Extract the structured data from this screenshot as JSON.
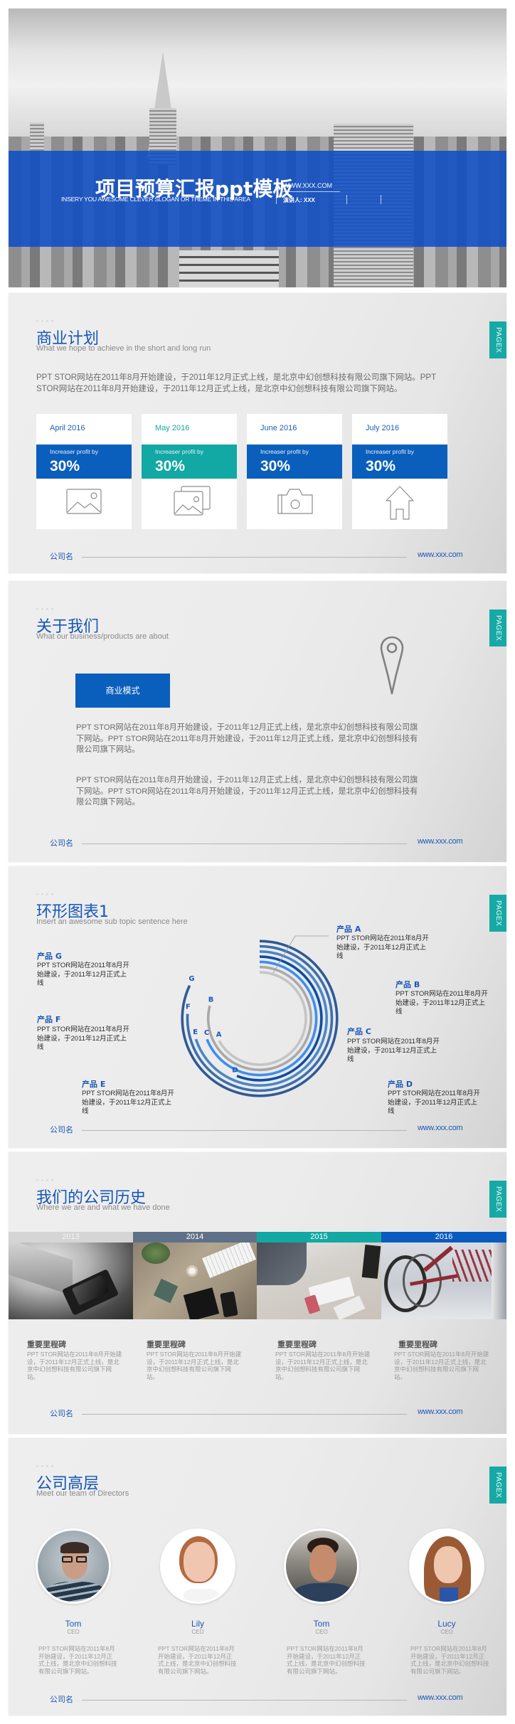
{
  "cover": {
    "title": "项目预算汇报ppt模板",
    "slogan": "INSERY YOU AWESOME CLEVER SLOGAN OR THEME IN THIS AREA",
    "website": "WWW.XXX.COM",
    "speaker": "演讲人: XXX",
    "band_color": "#104ec4"
  },
  "common": {
    "decor_dots": "• • • •",
    "page_tab": "PAGEX",
    "footer_company": "公司名",
    "footer_url": "www.xxx.com",
    "accent_blue": "#0b5fbc",
    "accent_teal": "#17a9a5"
  },
  "business_plan": {
    "title": "商业计划",
    "subtitle": "What we hope to achieve  in the short and long run",
    "body": "PPT STOR网站在2011年8月开始建设，于2011年12月正式上线，是北京中幻创想科技有限公司旗下网站。PPT STOR网站在2011年8月开始建设，于2011年12月正式上线，是北京中幻创想科技有限公司旗下网站。",
    "cards": [
      {
        "month": "April 2016",
        "label": "Increaser  profit by",
        "value": "30%",
        "icon": "image-icon",
        "highlight": false
      },
      {
        "month": "May  2016",
        "label": "Increaser  profit by",
        "value": "30%",
        "icon": "images-icon",
        "highlight": true
      },
      {
        "month": "June 2016",
        "label": "Increaser  profit by",
        "value": "30%",
        "icon": "camera-icon",
        "highlight": false
      },
      {
        "month": "July 2016",
        "label": "Increaser  profit by",
        "value": "30%",
        "icon": "home-icon",
        "highlight": false
      }
    ]
  },
  "about": {
    "title": "关于我们",
    "subtitle": "What our business/products are about",
    "button": "商业模式",
    "icon": "location-pin-icon",
    "paragraphs": [
      "PPT STOR网站在2011年8月开始建设，于2011年12月正式上线，是北京中幻创想科技有限公司旗下网站。PPT STOR网站在2011年8月开始建设，于2011年12月正式上线，是北京中幻创想科技有限公司旗下网站。",
      "PPT STOR网站在2011年8月开始建设，于2011年12月正式上线，是北京中幻创想科技有限公司旗下网站。PPT STOR网站在2011年8月开始建设，于2011年12月正式上线，是北京中幻创想科技有限公司旗下网站。"
    ]
  },
  "ring_slide": {
    "title": "环形图表1",
    "subtitle": "Insert an awesome  sub topic sentence here",
    "products": [
      {
        "name": "产品 A",
        "text": "PPT STOR网站在2011年8月开始建设，于2011年12月正式上线"
      },
      {
        "name": "产品 B",
        "text": "PPT STOR网站在2011年8月开始建设，于2011年12月正式上线"
      },
      {
        "name": "产品 C",
        "text": "PPT STOR网站在2011年8月开始建设，于2011年12月正式上线"
      },
      {
        "name": "产品 D",
        "text": "PPT STOR网站在2011年8月开始建设，于2011年12月正式上线"
      },
      {
        "name": "产品 E",
        "text": "PPT STOR网站在2011年8月开始建设，于2011年12月正式上线"
      },
      {
        "name": "产品 F",
        "text": "PPT STOR网站在2011年8月开始建设，于2011年12月正式上线"
      },
      {
        "name": "产品 G",
        "text": "PPT STOR网站在2011年8月开始建设，于2011年12月正式上线"
      }
    ]
  },
  "chart_data": {
    "type": "radial-bar",
    "title": "环形图表1",
    "start": "top",
    "direction": "clockwise",
    "categories": [
      "A",
      "B",
      "C",
      "D",
      "E",
      "F",
      "G"
    ],
    "values": [
      67,
      79,
      69,
      56,
      70,
      76,
      82
    ],
    "unit": "percent of full circle (estimated)",
    "colors": [
      "#c4c4c4",
      "#a9a9a9",
      "#3d8ef2",
      "#0c4ea6",
      "#4a86c6",
      "#3a6fb0",
      "#2e5a96"
    ],
    "order": "A innermost to G outermost",
    "legend": "none"
  },
  "history": {
    "title": "我们的公司历史",
    "subtitle": "Where we are and what we have  done",
    "years": [
      {
        "year": "2013",
        "color": "#d5d5d5",
        "photo": "laptop-phone-photo"
      },
      {
        "year": "2014",
        "color": "#5f7189",
        "photo": "desk-keyboard-photo"
      },
      {
        "year": "2015",
        "color": "#13a8a4",
        "photo": "businessman-desk-photo"
      },
      {
        "year": "2016",
        "color": "#0a5bbf",
        "photo": "bicycles-photo"
      }
    ],
    "milestones": [
      {
        "title": "重要里程碑",
        "text": "PPT STOR网站在2011年8月开始建设，于2011年12月正式上线，是北京中幻创想科技有限公司旗下网站。"
      },
      {
        "title": "重要里程碑",
        "text": "PPT STOR网站在2011年8月开始建设，于2011年12月正式上线，是北京中幻创想科技有限公司旗下网站。"
      },
      {
        "title": "重要里程碑",
        "text": "PPT STOR网站在2011年8月开始建设，于2011年12月正式上线，是北京中幻创想科技有限公司旗下网站。"
      },
      {
        "title": "重要里程碑",
        "text": "PPT STOR网站在2011年8月开始建设，于2011年12月正式上线，是北京中幻创想科技有限公司旗下网站。"
      }
    ]
  },
  "team": {
    "title": "公司高层",
    "subtitle": "Meet our team of Directors",
    "members": [
      {
        "name": "Tom",
        "role": "CEO",
        "desc": "PPT STOR网站在2011年8月开始建设，于2011年12月正式上线，是北京中幻创想科技有限公司旗下网站。"
      },
      {
        "name": "Lily",
        "role": "CEO",
        "desc": "PPT STOR网站在2011年8月开始建设，于2011年12月正式上线，是北京中幻创想科技有限公司旗下网站。"
      },
      {
        "name": "Tom",
        "role": "CEO",
        "desc": "PPT STOR网站在2011年8月开始建设，于2011年12月正式上线，是北京中幻创想科技有限公司旗下网站。"
      },
      {
        "name": "Lucy",
        "role": "CEO",
        "desc": "PPT STOR网站在2011年8月开始建设，于2011年12月正式上线，是北京中幻创想科技有限公司旗下网站。"
      }
    ]
  }
}
